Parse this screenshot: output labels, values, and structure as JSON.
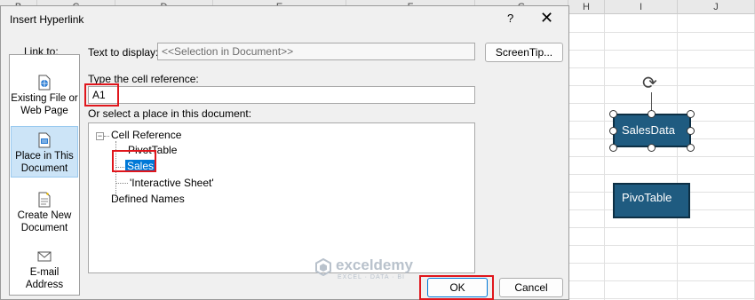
{
  "spreadsheet": {
    "columns": [
      "B",
      "C",
      "D",
      "E",
      "F",
      "G",
      "H",
      "I",
      "J"
    ],
    "edge_glyphs": [
      "a",
      "I",
      "P",
      "("
    ],
    "shapes": {
      "sales_data": "SalesData",
      "pivo_table": "PivoTable"
    },
    "shape_color": "#1f5b80"
  },
  "dialog": {
    "title": "Insert Hyperlink",
    "help_glyph": "?",
    "close_glyph": "✕",
    "link_to_label": "Link to:",
    "link_options": [
      {
        "label": "Existing File or Web Page",
        "icon": "file-web-icon"
      },
      {
        "label": "Place in This Document",
        "icon": "document-place-icon",
        "selected": true
      },
      {
        "label": "Create New Document",
        "icon": "new-document-icon"
      },
      {
        "label": "E-mail Address",
        "icon": "email-icon"
      }
    ],
    "text_to_display_label": "Text to display:",
    "text_to_display_value": "<<Selection in Document>>",
    "screentip_label": "ScreenTip...",
    "cell_ref_label": "Type the cell reference:",
    "cell_ref_value": "A1",
    "place_label": "Or select a place in this document:",
    "tree": {
      "cell_reference": "Cell Reference",
      "expander": "−",
      "children": [
        "PivotTable",
        "Sales",
        "'Interactive Sheet'"
      ],
      "selected": "Sales",
      "defined_names": "Defined Names"
    },
    "ok_label": "OK",
    "cancel_label": "Cancel",
    "accent_color": "#0078d7",
    "highlight_color": "#e0161c"
  },
  "watermark": {
    "text": "exceldemy",
    "subtext": "EXCEL · DATA · BI"
  }
}
